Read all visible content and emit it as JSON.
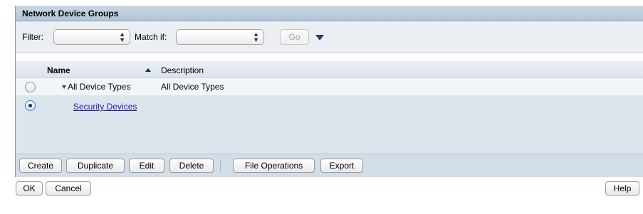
{
  "panel": {
    "title": "Network Device Groups"
  },
  "filter": {
    "filter_label": "Filter:",
    "filter_value": "",
    "match_label": "Match if:",
    "match_value": "",
    "go_label": "Go"
  },
  "table": {
    "columns": [
      "Name",
      "Description"
    ],
    "rows": [
      {
        "name": "All Device Types",
        "description": "All Device Types",
        "selected": false,
        "expanded": true
      },
      {
        "name": "Security Devices",
        "description": "",
        "selected": true,
        "is_link": true
      }
    ]
  },
  "toolbar": {
    "create": "Create",
    "duplicate": "Duplicate",
    "edit": "Edit",
    "delete": "Delete",
    "file_operations": "File Operations",
    "export": "Export"
  },
  "footer": {
    "ok": "OK",
    "cancel": "Cancel",
    "help": "Help"
  },
  "colors": {
    "header_bg": "#b8c9da",
    "row_bg": "#dce4ec",
    "link": "#2222aa"
  }
}
